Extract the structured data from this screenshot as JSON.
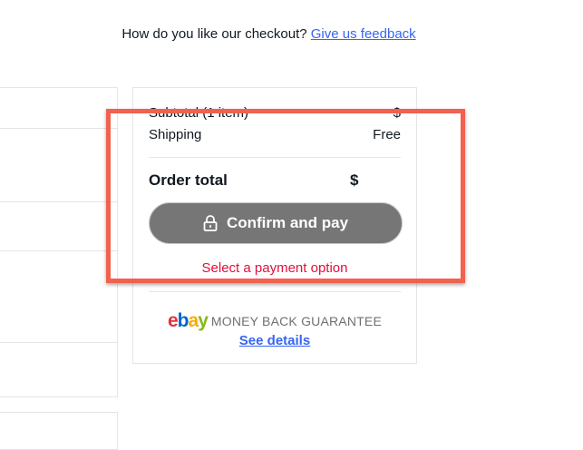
{
  "feedback": {
    "question": "How do you like our checkout?",
    "link_label": "Give us feedback"
  },
  "summary": {
    "subtotal_label": "Subtotal (1 item)",
    "subtotal_value": "$",
    "shipping_label": "Shipping",
    "shipping_value": "Free",
    "order_total_label": "Order total",
    "order_total_value": "$",
    "confirm_button_label": "Confirm and pay",
    "payment_error": "Select a payment option"
  },
  "guarantee": {
    "logo_letters": [
      "e",
      "b",
      "a",
      "y"
    ],
    "text": "MONEY BACK GUARANTEE",
    "details_link": "See details"
  },
  "colors": {
    "link": "#3665f3",
    "error": "#e0103a",
    "button_disabled": "#767676",
    "highlight": "#f0614f"
  }
}
